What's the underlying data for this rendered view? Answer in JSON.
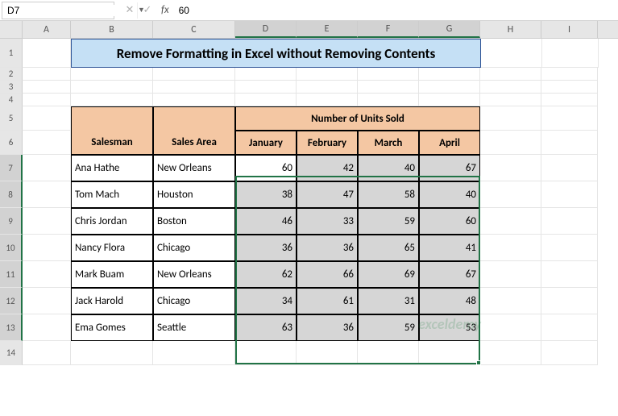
{
  "namebox": "D7",
  "formula": "60",
  "columns": [
    "A",
    "B",
    "C",
    "D",
    "E",
    "F",
    "G",
    "H",
    "I"
  ],
  "row_nums": [
    "1",
    "2",
    "3",
    "4",
    "5",
    "6",
    "7",
    "8",
    "9",
    "10",
    "11",
    "12",
    "13",
    "14"
  ],
  "title": "Remove Formatting in Excel without Removing Contents",
  "headers": {
    "salesman": "Salesman",
    "salesarea": "Sales Area",
    "units": "Number of Units Sold",
    "jan": "January",
    "feb": "February",
    "mar": "March",
    "apr": "April"
  },
  "rows": [
    {
      "name": "Ana Hathe",
      "area": "New Orleans",
      "v": [
        "60",
        "42",
        "40",
        "67"
      ]
    },
    {
      "name": "Tom Mach",
      "area": "Houston",
      "v": [
        "38",
        "47",
        "58",
        "40"
      ]
    },
    {
      "name": "Chris Jordan",
      "area": "Boston",
      "v": [
        "46",
        "33",
        "59",
        "60"
      ]
    },
    {
      "name": "Nancy Flora",
      "area": "Chicago",
      "v": [
        "36",
        "36",
        "65",
        "41"
      ]
    },
    {
      "name": "Mark Buam",
      "area": "New Orleans",
      "v": [
        "62",
        "66",
        "69",
        "67"
      ]
    },
    {
      "name": "Jack Harold",
      "area": "Chicago",
      "v": [
        "34",
        "61",
        "31",
        "48"
      ]
    },
    {
      "name": "Ema Gomes",
      "area": "Seattle",
      "v": [
        "63",
        "36",
        "59",
        "53"
      ]
    }
  ],
  "watermark": "exceldemy",
  "chart_data": {
    "type": "table",
    "title": "Number of Units Sold",
    "categories": [
      "January",
      "February",
      "March",
      "April"
    ],
    "series": [
      {
        "name": "Ana Hathe",
        "values": [
          60,
          42,
          40,
          67
        ]
      },
      {
        "name": "Tom Mach",
        "values": [
          38,
          47,
          58,
          40
        ]
      },
      {
        "name": "Chris Jordan",
        "values": [
          46,
          33,
          59,
          60
        ]
      },
      {
        "name": "Nancy Flora",
        "values": [
          36,
          36,
          65,
          41
        ]
      },
      {
        "name": "Mark Buam",
        "values": [
          62,
          66,
          69,
          67
        ]
      },
      {
        "name": "Jack Harold",
        "values": [
          34,
          61,
          31,
          48
        ]
      },
      {
        "name": "Ema Gomes",
        "values": [
          63,
          36,
          59,
          53
        ]
      }
    ]
  }
}
